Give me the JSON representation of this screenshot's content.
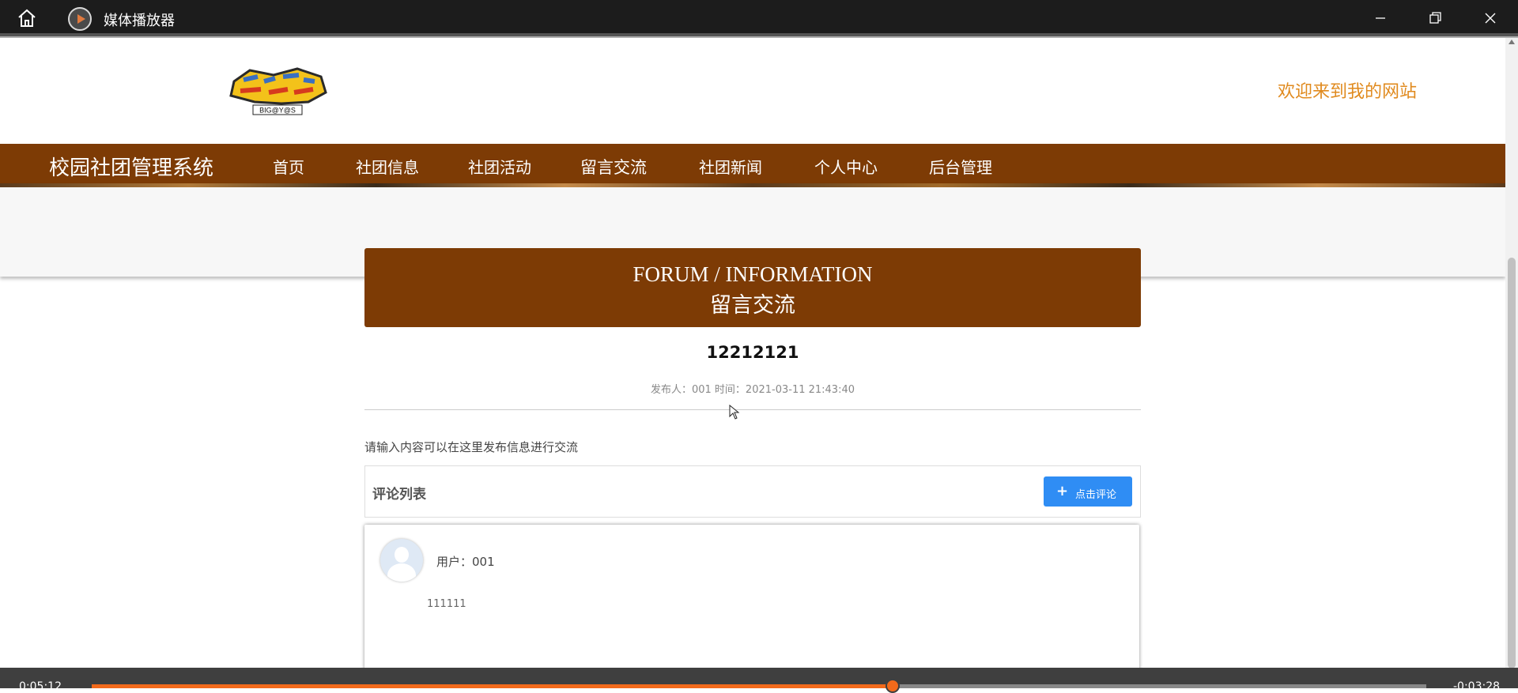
{
  "window": {
    "title": "媒体播放器",
    "icons": [
      "home-icon",
      "media-player-icon",
      "minimize-icon",
      "restore-icon",
      "close-icon"
    ]
  },
  "site": {
    "welcome": "欢迎来到我的网站",
    "logo_text": "BIG@Y@S"
  },
  "nav": {
    "brand": "校园社团管理系统",
    "items": [
      "首页",
      "社团信息",
      "社团活动",
      "留言交流",
      "社团新闻",
      "个人中心",
      "后台管理"
    ],
    "active_index": 3
  },
  "carousel": {
    "slide_count": 3,
    "active_index": 0
  },
  "forum": {
    "heading_en": "FORUM / INFORMATION",
    "heading_cn": "留言交流"
  },
  "post": {
    "title": "12212121",
    "meta": "发布人：001 时间：2021-03-11 21:43:40"
  },
  "hint": "请输入内容可以在这里发布信息进行交流",
  "comments": {
    "title": "评论列表",
    "add_button": "点击评论",
    "items": [
      {
        "user": "用户：001",
        "content": "111111"
      }
    ]
  },
  "player": {
    "elapsed": "0:05:12",
    "remaining": "-0:03:28",
    "progress": 0.6
  },
  "colors": {
    "nav_bg": "#7d3b05",
    "accent_orange": "#f5821f",
    "button_blue": "#2f8df4",
    "welcome": "#e08a1e"
  }
}
